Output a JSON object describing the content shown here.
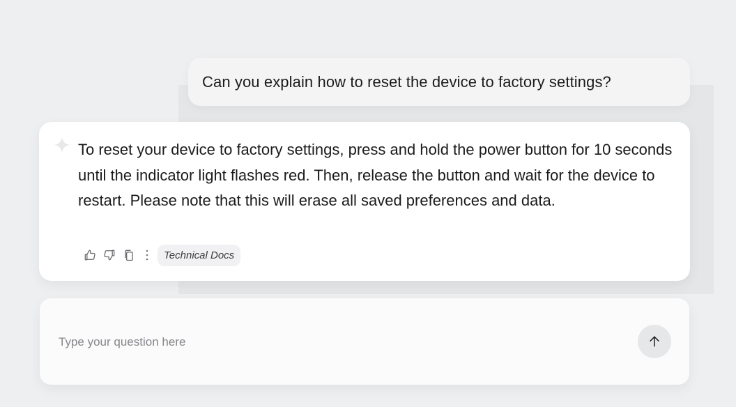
{
  "conversation": {
    "user_message": "Can you explain how to reset the device to factory settings?",
    "assistant_message": "To reset your device to factory settings, press and hold the power button for 10 seconds until the indicator light flashes red. Then, release the button and wait for the device to restart. Please note that this will erase all saved preferences and data.",
    "source_tag": "Technical Docs"
  },
  "composer": {
    "placeholder": "Type your question here"
  },
  "icons": {
    "assistant": "sparkle-icon",
    "actions": [
      "thumbs-up-icon",
      "thumbs-down-icon",
      "copy-icon",
      "more-vertical-icon"
    ],
    "send": "arrow-up-icon"
  },
  "colors": {
    "background": "#eeeff1",
    "card": "#ffffff",
    "user_bubble": "#f4f4f5",
    "send_button": "#e6e7e9"
  }
}
